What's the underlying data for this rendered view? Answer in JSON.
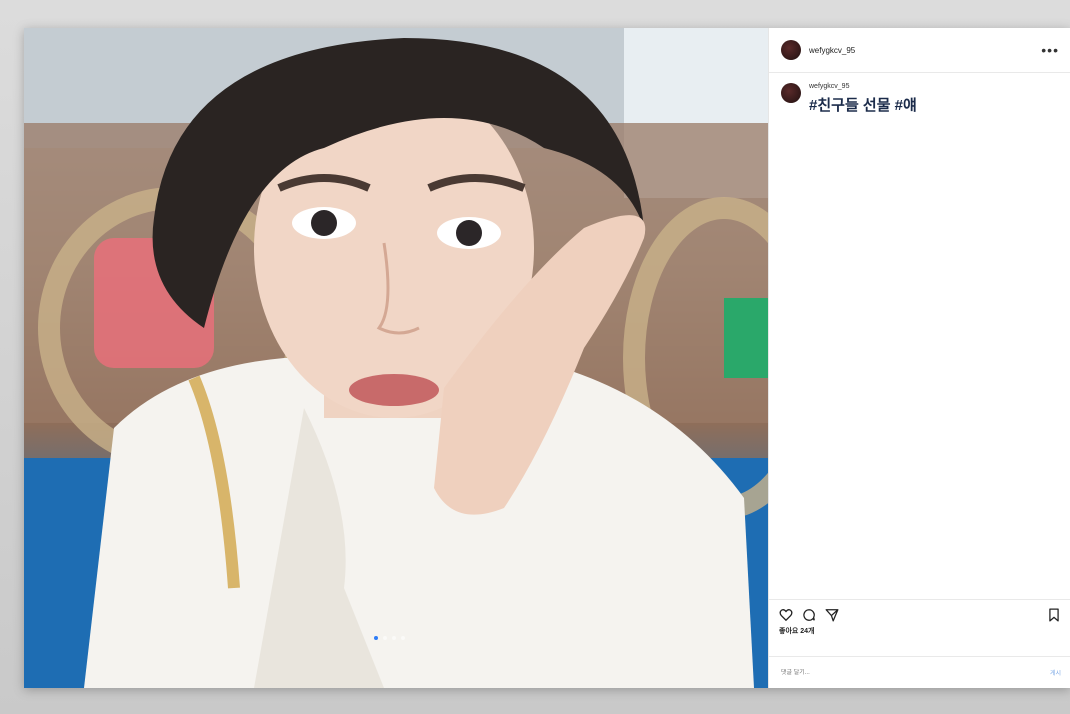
{
  "post": {
    "username": "wefygkcv_95",
    "caption_username": "wefygkcv_95",
    "caption_tags": "#친구들 선물 #얘",
    "likes": "좋아요 24개",
    "comment_placeholder": "댓글 달기...",
    "post_button": "게시",
    "carousel": {
      "count": 4,
      "active_index": 0
    }
  },
  "icons": {
    "more": "more-icon",
    "like": "heart-icon",
    "comment": "comment-icon",
    "share": "send-icon",
    "save": "bookmark-icon"
  },
  "colors": {
    "active_dot": "#2e7cf6",
    "post_button": "#7aa8e6"
  }
}
